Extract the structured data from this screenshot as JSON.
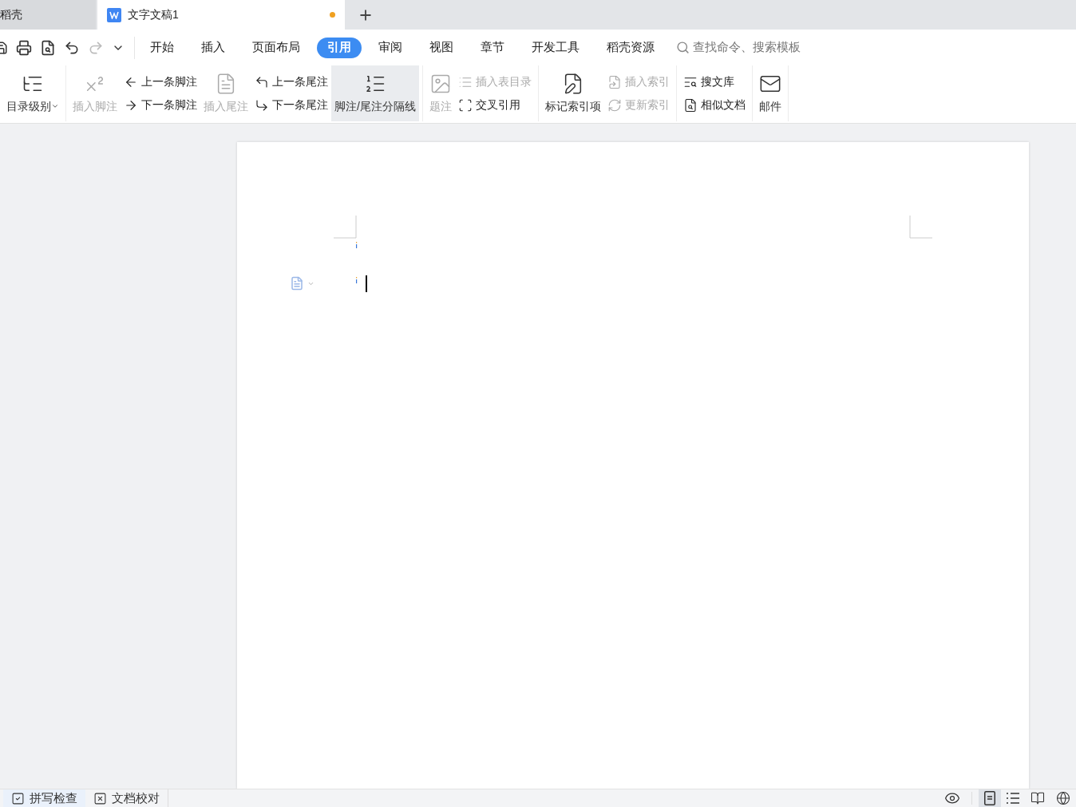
{
  "tabs": [
    {
      "label": "稻壳",
      "selected": false,
      "modified": false
    },
    {
      "label": "文字文稿1",
      "selected": true,
      "modified": true
    }
  ],
  "menu": [
    {
      "label": "开始",
      "selected": false
    },
    {
      "label": "插入",
      "selected": false
    },
    {
      "label": "页面布局",
      "selected": false
    },
    {
      "label": "引用",
      "selected": true
    },
    {
      "label": "审阅",
      "selected": false
    },
    {
      "label": "视图",
      "selected": false
    },
    {
      "label": "章节",
      "selected": false
    },
    {
      "label": "开发工具",
      "selected": false
    },
    {
      "label": "稻壳资源",
      "selected": false
    }
  ],
  "search": {
    "placeholder": "查找命令、搜索模板"
  },
  "ribbon": {
    "groups": [
      {
        "items": [
          {
            "kind": "large",
            "label": "目录级别",
            "disabled": false,
            "dropdown": true,
            "hovered": false
          }
        ]
      },
      {
        "items": [
          {
            "kind": "large",
            "label": "插入脚注",
            "disabled": true,
            "dropdown": false,
            "hovered": false
          },
          {
            "kind": "stack",
            "items": [
              {
                "label": "上一条脚注",
                "disabled": false
              },
              {
                "label": "下一条脚注",
                "disabled": false
              }
            ]
          },
          {
            "kind": "large",
            "label": "插入尾注",
            "disabled": true,
            "dropdown": false,
            "hovered": false
          },
          {
            "kind": "stack",
            "items": [
              {
                "label": "上一条尾注",
                "disabled": false
              },
              {
                "label": "下一条尾注",
                "disabled": false
              }
            ]
          },
          {
            "kind": "large",
            "label": "脚注/尾注分隔线",
            "disabled": false,
            "dropdown": false,
            "hovered": true
          }
        ]
      },
      {
        "items": [
          {
            "kind": "large",
            "label": "题注",
            "disabled": true,
            "dropdown": false,
            "hovered": false
          },
          {
            "kind": "stack",
            "items": [
              {
                "label": "插入表目录",
                "disabled": true
              },
              {
                "label": "交叉引用",
                "disabled": false
              }
            ]
          }
        ]
      },
      {
        "items": [
          {
            "kind": "large",
            "label": "标记索引项",
            "disabled": false,
            "dropdown": false,
            "hovered": false
          },
          {
            "kind": "stack",
            "items": [
              {
                "label": "插入索引",
                "disabled": true
              },
              {
                "label": "更新索引",
                "disabled": true
              }
            ]
          }
        ]
      },
      {
        "items": [
          {
            "kind": "stack",
            "items": [
              {
                "label": "搜文库",
                "disabled": false
              },
              {
                "label": "相似文档",
                "disabled": false
              }
            ]
          }
        ]
      },
      {
        "items": [
          {
            "kind": "large",
            "label": "邮件",
            "disabled": false,
            "dropdown": false,
            "hovered": false
          }
        ]
      }
    ]
  },
  "status_bar": {
    "items": [
      {
        "label": "拼写检查",
        "checked": true
      },
      {
        "label": "文档校对",
        "checked": false
      }
    ],
    "views": [
      {
        "kind": "page",
        "selected": true
      },
      {
        "kind": "outline",
        "selected": false
      },
      {
        "kind": "read",
        "selected": false
      },
      {
        "kind": "web",
        "selected": false
      }
    ]
  }
}
